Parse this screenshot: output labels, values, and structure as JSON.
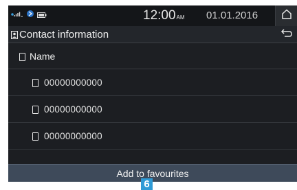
{
  "status_bar": {
    "time": "12:00",
    "ampm": "AM",
    "date": "01.01.2016",
    "icons": [
      "bluetooth-signal-icon",
      "network-icon",
      "battery-icon"
    ]
  },
  "header": {
    "title": "Contact information",
    "title_icon": "contact-card-icon",
    "back_icon": "back-arrow-icon",
    "home_icon": "home-icon"
  },
  "contact": {
    "name_label": "Name",
    "numbers": [
      "00000000000",
      "00000000000",
      "00000000000"
    ]
  },
  "actions": {
    "add_favourites_label": "Add to favourites"
  },
  "callout": {
    "label": "6",
    "color": "#2f9bd6"
  }
}
